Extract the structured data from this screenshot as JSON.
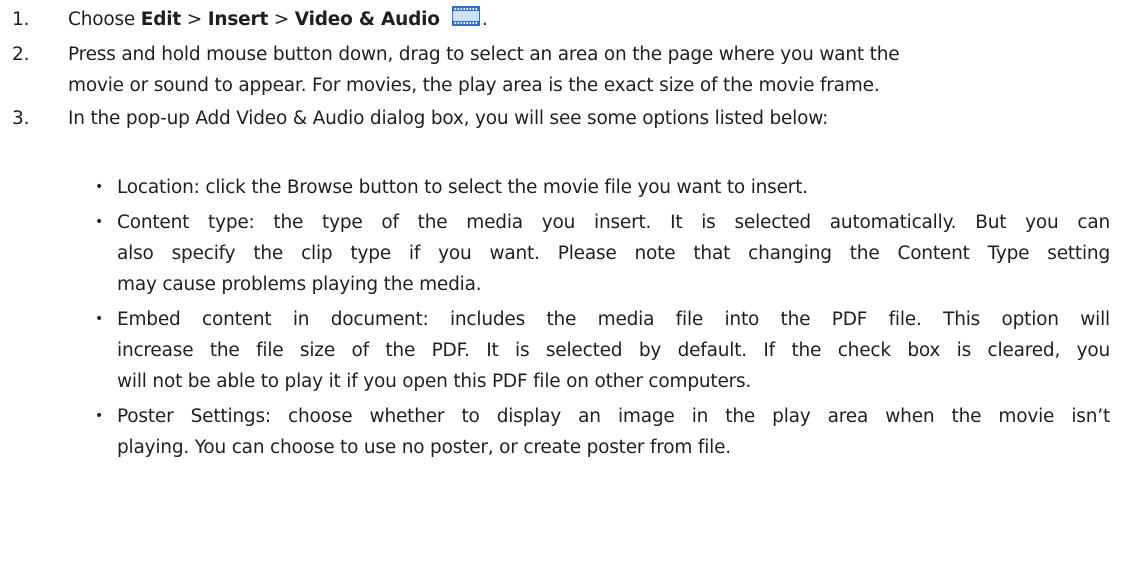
{
  "steps": [
    {
      "number": "1.",
      "prefix": "Choose ",
      "edit": "Edit",
      "sep1": " > ",
      "insert": "Insert",
      "sep2": " > ",
      "video_audio": "Video & Audio",
      "suffix": "."
    },
    {
      "number": "2.",
      "lines": [
        "Press and hold mouse button down, drag to select an area on the page where you want the",
        "movie or sound to appear. For movies, the play area is the exact size of the movie frame."
      ]
    },
    {
      "number": "3.",
      "lines": [
        "In the pop-up Add Video & Audio dialog box, you will see some options listed below:"
      ]
    }
  ],
  "bullets": [
    {
      "lines": [
        "Location: click the Browse button to select the movie file you want to insert."
      ]
    },
    {
      "lines": [
        "Content type: the type of the media you insert. It is selected automatically. But you can",
        "also specify the clip type if you want. Please note that changing the Content Type setting",
        "may cause problems playing the media."
      ]
    },
    {
      "lines": [
        "Embed content in document: includes the media file into the PDF file. This option will",
        "increase the file size of the PDF. It is selected by default. If the check box is cleared, you",
        "will not be able to play it if you open this PDF file on other computers."
      ]
    },
    {
      "lines": [
        "Poster Settings: choose whether to display an image in the play area when the movie isn’t",
        "playing. You can choose to use no poster, or create poster from file."
      ]
    }
  ],
  "bullet_symbol": "•",
  "icons": {
    "video_audio": "film-strip-icon"
  },
  "colors": {
    "text": "#1f1f1f",
    "icon_blue": "#2e6fd0",
    "icon_fill": "#cfe3f7"
  }
}
